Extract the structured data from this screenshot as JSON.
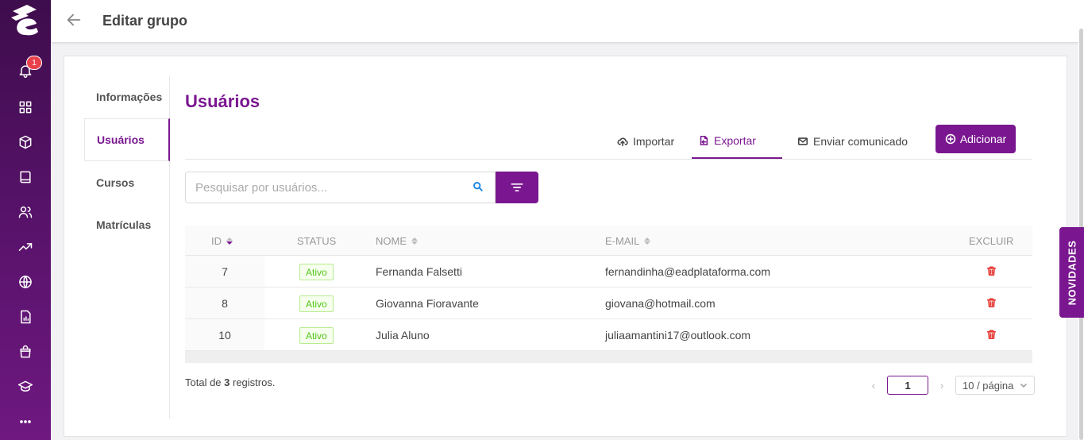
{
  "header": {
    "title": "Editar grupo"
  },
  "sidebar": {
    "notification_count": "1",
    "items": [
      {
        "icon": "bell-icon"
      },
      {
        "icon": "grid-icon"
      },
      {
        "icon": "box-icon"
      },
      {
        "icon": "book-icon"
      },
      {
        "icon": "users-icon"
      },
      {
        "icon": "trending-icon"
      },
      {
        "icon": "globe-icon"
      },
      {
        "icon": "report-icon"
      },
      {
        "icon": "shopping-bag-icon"
      },
      {
        "icon": "graduation-cap-icon"
      },
      {
        "icon": "more-icon"
      }
    ]
  },
  "tabs": [
    "Informações",
    "Usuários",
    "Cursos",
    "Matrículas"
  ],
  "active_tab": "Usuários",
  "section_title": "Usuários",
  "actions": {
    "import_label": "Importar",
    "export_label": "Exportar",
    "send_label": "Enviar comunicado",
    "add_label": "Adicionar"
  },
  "search": {
    "placeholder": "Pesquisar por usuários..."
  },
  "table": {
    "columns": {
      "id": "ID",
      "status": "STATUS",
      "name": "NOME",
      "email": "E-MAIL",
      "delete": "EXCLUIR"
    },
    "rows": [
      {
        "id": "7",
        "status": "Ativo",
        "name": "Fernanda Falsetti",
        "email": "fernandinha@eadplataforma.com"
      },
      {
        "id": "8",
        "status": "Ativo",
        "name": "Giovanna Fioravante",
        "email": "giovana@hotmail.com"
      },
      {
        "id": "10",
        "status": "Ativo",
        "name": "Julia Aluno",
        "email": "juliaamantini17@outlook.com"
      }
    ]
  },
  "footer": {
    "total_prefix": "Total de ",
    "total_count": "3",
    "total_suffix": " registros.",
    "page": "1",
    "page_size": "10 / página"
  },
  "novidades_label": "NOVIDADES",
  "colors": {
    "brand": "#7a1790",
    "sidebar": "#4f1060",
    "status_green": "#52c41a",
    "delete_red": "#e53935"
  }
}
